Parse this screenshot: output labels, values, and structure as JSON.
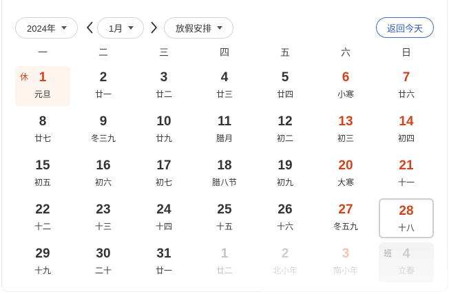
{
  "toolbar": {
    "year_label": "2024年",
    "month_label": "1月",
    "holiday_label": "放假安排",
    "today_button": "返回今天"
  },
  "weekdays": [
    "一",
    "二",
    "三",
    "四",
    "五",
    "六",
    "日"
  ],
  "days": [
    {
      "num": "1",
      "sub": "元旦",
      "badge": "休",
      "state": "holiday"
    },
    {
      "num": "2",
      "sub": "廿一"
    },
    {
      "num": "3",
      "sub": "廿二"
    },
    {
      "num": "4",
      "sub": "廿三"
    },
    {
      "num": "5",
      "sub": "廿四"
    },
    {
      "num": "6",
      "sub": "小寒",
      "weekend": true
    },
    {
      "num": "7",
      "sub": "廿六",
      "weekend": true
    },
    {
      "num": "8",
      "sub": "廿七"
    },
    {
      "num": "9",
      "sub": "冬三九"
    },
    {
      "num": "10",
      "sub": "廿九"
    },
    {
      "num": "11",
      "sub": "腊月"
    },
    {
      "num": "12",
      "sub": "初二"
    },
    {
      "num": "13",
      "sub": "初三",
      "weekend": true
    },
    {
      "num": "14",
      "sub": "初四",
      "weekend": true
    },
    {
      "num": "15",
      "sub": "初五"
    },
    {
      "num": "16",
      "sub": "初六"
    },
    {
      "num": "17",
      "sub": "初七"
    },
    {
      "num": "18",
      "sub": "腊八节"
    },
    {
      "num": "19",
      "sub": "初九"
    },
    {
      "num": "20",
      "sub": "大寒",
      "weekend": true
    },
    {
      "num": "21",
      "sub": "十一",
      "weekend": true
    },
    {
      "num": "22",
      "sub": "十二"
    },
    {
      "num": "23",
      "sub": "十三"
    },
    {
      "num": "24",
      "sub": "十四"
    },
    {
      "num": "25",
      "sub": "十五"
    },
    {
      "num": "26",
      "sub": "十六"
    },
    {
      "num": "27",
      "sub": "冬五九",
      "weekend": true
    },
    {
      "num": "28",
      "sub": "十八",
      "weekend": true,
      "state": "today"
    },
    {
      "num": "29",
      "sub": "十九"
    },
    {
      "num": "30",
      "sub": "二十"
    },
    {
      "num": "31",
      "sub": "廿一"
    },
    {
      "num": "1",
      "sub": "廿二",
      "state": "other"
    },
    {
      "num": "2",
      "sub": "北小年",
      "state": "other"
    },
    {
      "num": "3",
      "sub": "南小年",
      "state": "other",
      "weekend": true
    },
    {
      "num": "4",
      "sub": "立春",
      "state": "other workday",
      "badge": "班"
    }
  ]
}
